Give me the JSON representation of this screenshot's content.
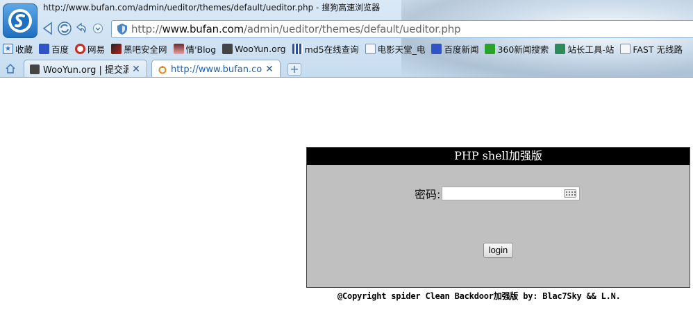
{
  "window": {
    "title": "http://www.bufan.com/admin/ueditor/themes/default/ueditor.php - 搜狗高速浏览器"
  },
  "address_bar": {
    "scheme": "http://",
    "host": "www.bufan.com",
    "path": "/admin/ueditor/themes/default/ueditor.php"
  },
  "bookmarks": [
    {
      "label": "收藏",
      "icon": "star-icon",
      "color": "#2e6fcf"
    },
    {
      "label": "百度",
      "icon": "baidu-paw-icon",
      "color": "#2f54c6"
    },
    {
      "label": "网易",
      "icon": "netease-icon",
      "color": "#d0261d"
    },
    {
      "label": "黑吧安全网",
      "icon": "heiba-icon",
      "color": "#b3261e"
    },
    {
      "label": "情'Blog",
      "icon": "avatar-icon",
      "color": "#c06060"
    },
    {
      "label": "WooYun.org",
      "icon": "wooyun-icon",
      "color": "#444444"
    },
    {
      "label": "md5在线查询",
      "icon": "grid-icon",
      "color": "#2a4f9e"
    },
    {
      "label": "电影天堂_电",
      "icon": "page-icon",
      "color": "#7a8fa6"
    },
    {
      "label": "百度新闻",
      "icon": "baidu-paw-icon",
      "color": "#2f54c6"
    },
    {
      "label": "360新闻搜索",
      "icon": "search-green-icon",
      "color": "#2aa32a"
    },
    {
      "label": "站长工具-站",
      "icon": "chinaz-icon",
      "color": "#2e8b57"
    },
    {
      "label": "FAST 无线路",
      "icon": "page-icon",
      "color": "#7a8fa6"
    }
  ],
  "tabs": [
    {
      "label": "WooYun.org | 提交漏",
      "icon": "wooyun-icon",
      "active": false
    },
    {
      "label": "http://www.bufan.com",
      "icon": "loading-icon",
      "active": true
    }
  ],
  "page": {
    "panel_title": "PHP shell加强版",
    "password_label": "密码:",
    "password_value": "",
    "login_label": "login",
    "copyright": "@Copyright spider Clean Backdoor加强版 by: Blac7Sky && L.N."
  }
}
